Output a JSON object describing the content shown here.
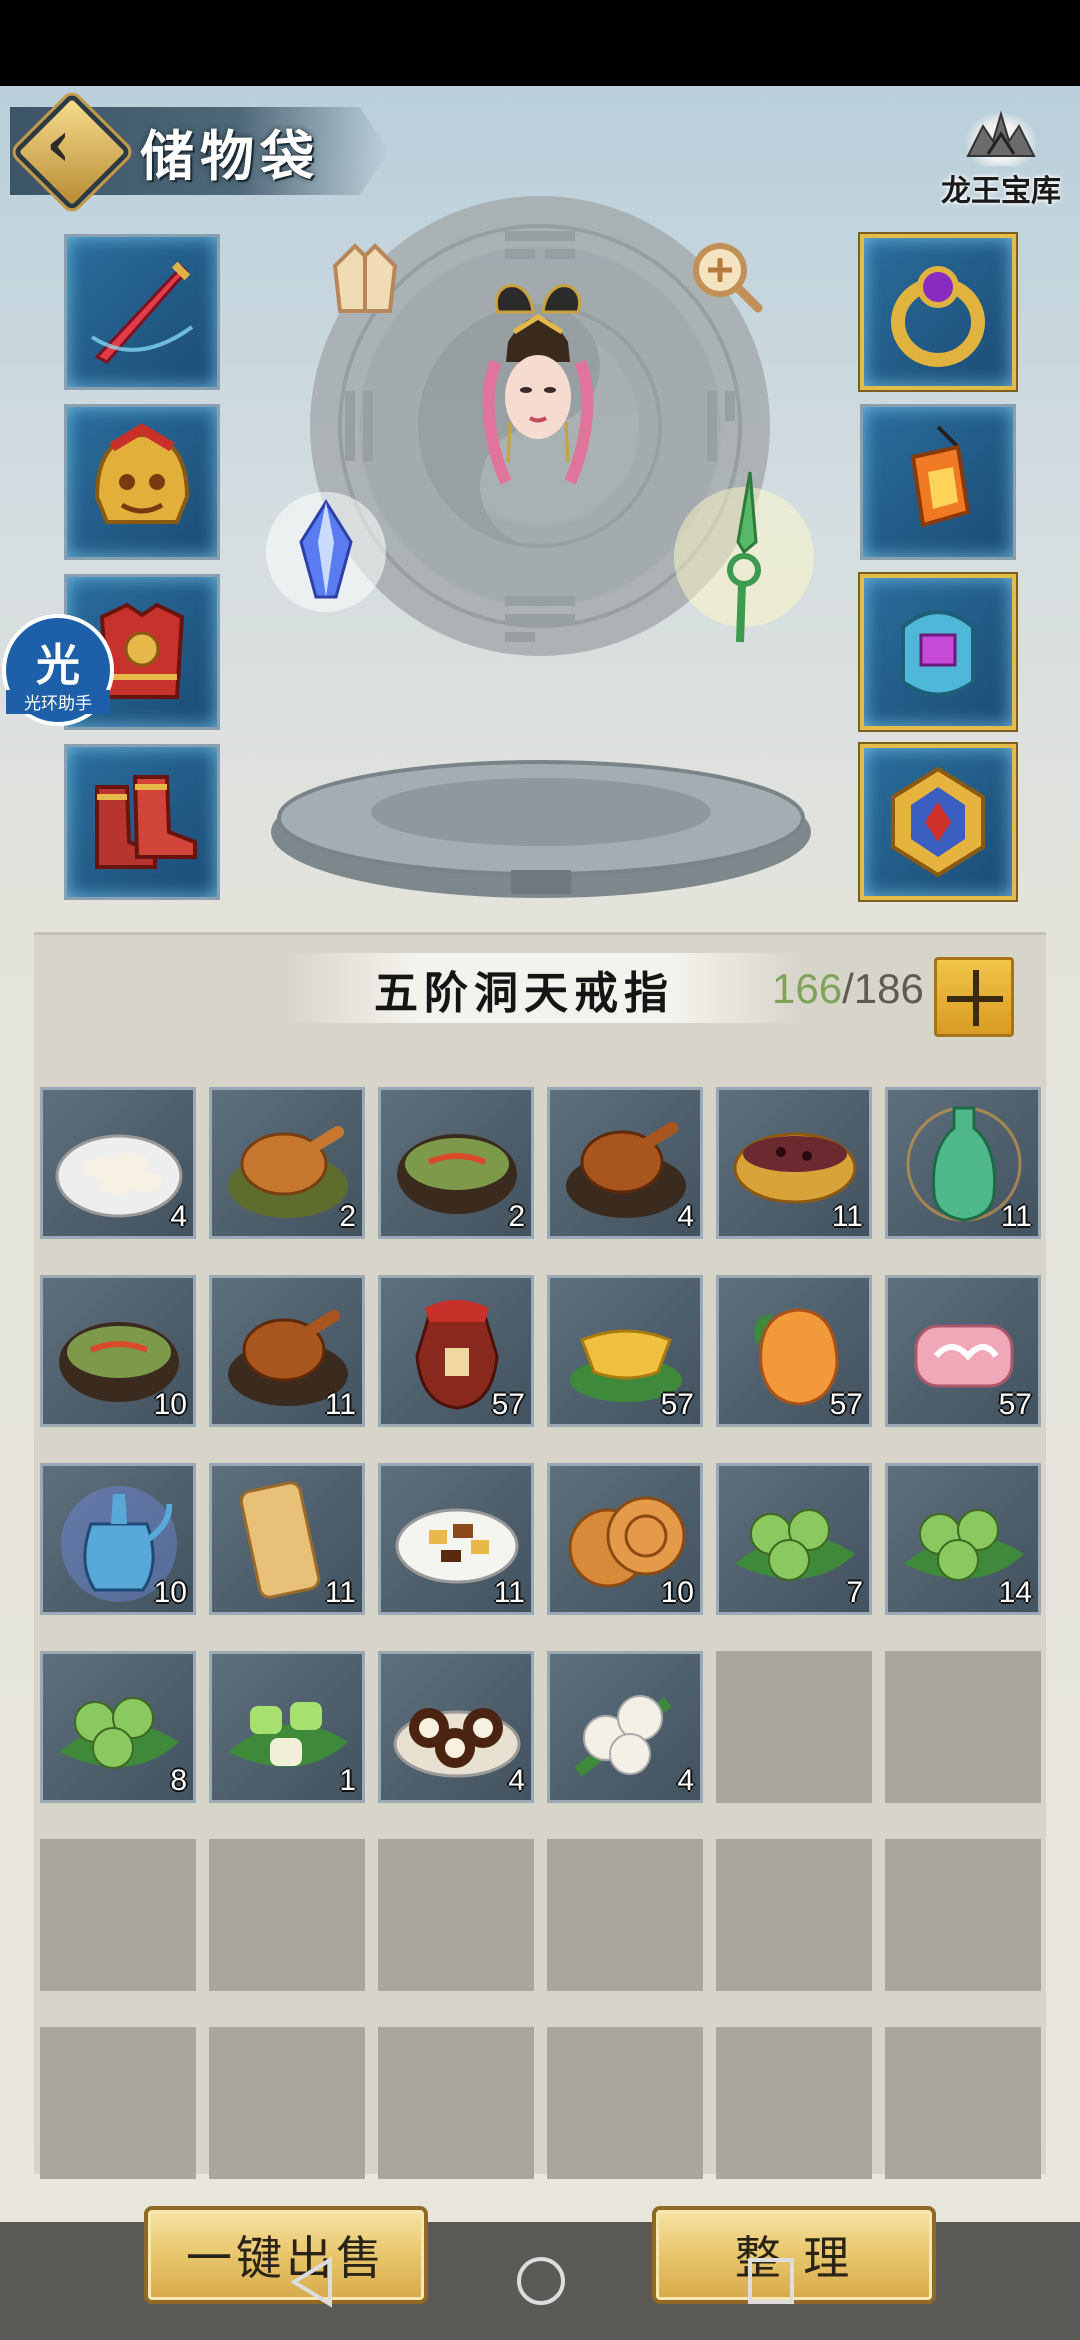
{
  "header": {
    "title": "储物袋",
    "vault_label": "龙王宝库"
  },
  "helper": {
    "glyph": "光",
    "label": "光环助手"
  },
  "equipment": {
    "left": [
      {
        "name": "sword"
      },
      {
        "name": "helmet"
      },
      {
        "name": "armor"
      },
      {
        "name": "boots"
      }
    ],
    "right": [
      {
        "name": "ring"
      },
      {
        "name": "lantern"
      },
      {
        "name": "amulet"
      },
      {
        "name": "talisman"
      }
    ],
    "center": [
      "cloak-icon",
      "magnify-icon",
      "crystal-icon",
      "jade-dagger-icon"
    ]
  },
  "inventory": {
    "title": "五阶洞天戒指",
    "used": "166",
    "separator": "/",
    "capacity": "186",
    "rows": [
      [
        {
          "icon": "dumplings",
          "qty": "4"
        },
        {
          "icon": "roast-chicken",
          "qty": "2"
        },
        {
          "icon": "noodle-bowl",
          "qty": "2"
        },
        {
          "icon": "roast-chicken-bowl",
          "qty": "4"
        },
        {
          "icon": "bean-porridge",
          "qty": "11"
        },
        {
          "icon": "green-vase",
          "qty": "11"
        }
      ],
      [
        {
          "icon": "noodle-bowl",
          "qty": "10"
        },
        {
          "icon": "roast-chicken-bowl",
          "qty": "11"
        },
        {
          "icon": "wine-jar",
          "qty": "57"
        },
        {
          "icon": "gold-ingot",
          "qty": "57"
        },
        {
          "icon": "peach",
          "qty": "57"
        },
        {
          "icon": "pink-cake",
          "qty": "57"
        }
      ],
      [
        {
          "icon": "blue-teapot",
          "qty": "10"
        },
        {
          "icon": "pancake-roll",
          "qty": "11"
        },
        {
          "icon": "mixed-plate",
          "qty": "11"
        },
        {
          "icon": "mooncake",
          "qty": "10"
        },
        {
          "icon": "green-dumplings",
          "qty": "7"
        },
        {
          "icon": "green-dumplings",
          "qty": "14"
        }
      ],
      [
        {
          "icon": "green-dumplings",
          "qty": "8"
        },
        {
          "icon": "green-cakes",
          "qty": "1"
        },
        {
          "icon": "chocolate-rolls",
          "qty": "4"
        },
        {
          "icon": "steamed-buns",
          "qty": "4"
        },
        null,
        null
      ],
      [
        null,
        null,
        null,
        null,
        null,
        null
      ],
      [
        null,
        null,
        null,
        null,
        null,
        null
      ]
    ]
  },
  "actions": {
    "sell_all": "一键出售",
    "sort": "整 理"
  },
  "colors": {
    "accent_gold": "#e2bd4a",
    "used_green": "#7da458"
  }
}
